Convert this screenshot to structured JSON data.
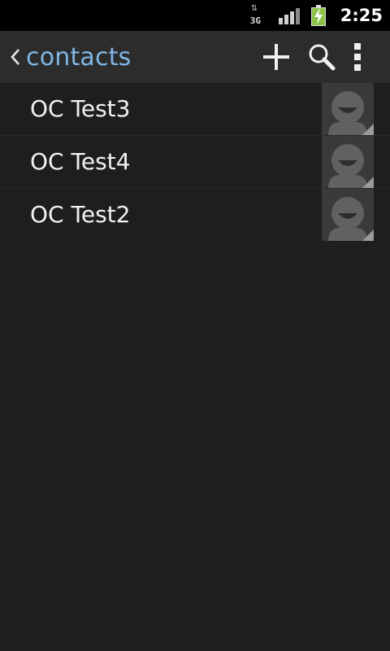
{
  "status_bar": {
    "network_label": "3G",
    "time": "2:25",
    "icons": [
      "data-activity-icon",
      "signal-strength-icon",
      "battery-charging-icon"
    ],
    "colors": {
      "battery": "#8bc34a"
    }
  },
  "action_bar": {
    "title": "contacts",
    "icons": [
      "chevron-left-icon",
      "add-icon",
      "search-icon",
      "overflow-menu-icon"
    ],
    "colors": {
      "title": "#7fb6e5",
      "background": "#2c2c2c"
    }
  },
  "contacts": [
    {
      "name": "OC Test3",
      "avatar": "default-contact-avatar-icon"
    },
    {
      "name": "OC Test4",
      "avatar": "default-contact-avatar-icon"
    },
    {
      "name": "OC Test2",
      "avatar": "default-contact-avatar-icon"
    }
  ]
}
